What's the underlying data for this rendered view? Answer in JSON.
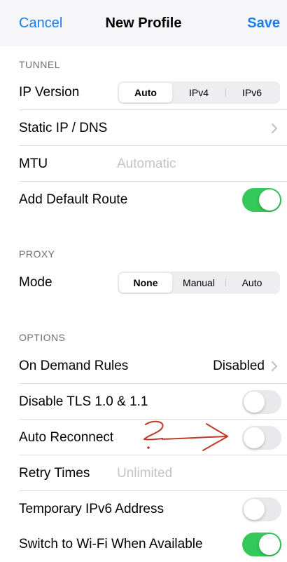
{
  "nav": {
    "cancel_label": "Cancel",
    "title": "New Profile",
    "save_label": "Save"
  },
  "colors": {
    "accent": "#1a7cf2",
    "toggle_on": "#34c759",
    "toggle_off": "#e9e9eb",
    "annotation": "#c0392b"
  },
  "sections": {
    "tunnel": {
      "header": "TUNNEL",
      "ip_version": {
        "label": "IP Version",
        "options": [
          "Auto",
          "IPv4",
          "IPv6"
        ],
        "selected": "Auto"
      },
      "static_ip": {
        "label": "Static IP / DNS",
        "icon": "chevron-right-icon"
      },
      "mtu": {
        "label": "MTU",
        "placeholder": "Automatic"
      },
      "default_route": {
        "label": "Add Default Route",
        "enabled": true
      }
    },
    "proxy": {
      "header": "PROXY",
      "mode": {
        "label": "Mode",
        "options": [
          "None",
          "Manual",
          "Auto"
        ],
        "selected": "None"
      }
    },
    "options": {
      "header": "OPTIONS",
      "on_demand": {
        "label": "On Demand Rules",
        "value": "Disabled",
        "icon": "chevron-right-icon"
      },
      "disable_tls": {
        "label": "Disable TLS 1.0 & 1.1",
        "enabled": false
      },
      "auto_reconnect": {
        "label": "Auto Reconnect",
        "enabled": false
      },
      "retry_times": {
        "label": "Retry Times",
        "placeholder": "Unlimited"
      },
      "temp_ipv6": {
        "label": "Temporary IPv6 Address",
        "enabled": false
      },
      "switch_wifi": {
        "label": "Switch to Wi-Fi When Available",
        "enabled": true
      }
    }
  },
  "annotation": {
    "icon": "handwritten-question-arrow",
    "target": "auto-reconnect-toggle"
  }
}
